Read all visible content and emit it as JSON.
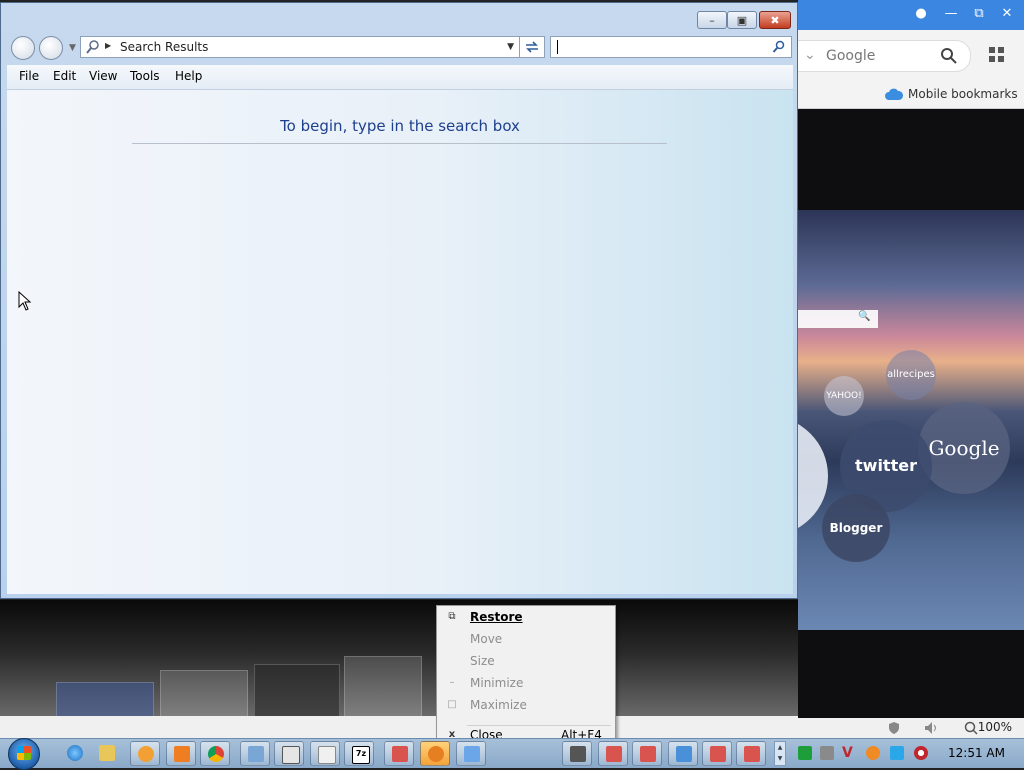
{
  "explorer": {
    "address_text": "Search Results",
    "menu": [
      "File",
      "Edit",
      "View",
      "Tools",
      "Help"
    ],
    "content_hint": "To begin, type in the search box",
    "search_value": ""
  },
  "context_menu": {
    "items": [
      {
        "label": "Restore",
        "icon": "restore-icon",
        "enabled": true,
        "bold": true,
        "shortcut": ""
      },
      {
        "label": "Move",
        "icon": "",
        "enabled": false,
        "bold": false,
        "shortcut": ""
      },
      {
        "label": "Size",
        "icon": "",
        "enabled": false,
        "bold": false,
        "shortcut": ""
      },
      {
        "label": "Minimize",
        "icon": "minimize-icon",
        "enabled": false,
        "bold": false,
        "shortcut": ""
      },
      {
        "label": "Maximize",
        "icon": "maximize-icon",
        "enabled": false,
        "bold": false,
        "shortcut": ""
      },
      {
        "label": "Close",
        "icon": "close-icon",
        "enabled": true,
        "bold": false,
        "shortcut": "Alt+F4"
      }
    ]
  },
  "background_browser": {
    "search_placeholder": "Google",
    "bookmarks_label": "Mobile bookmarks",
    "zoom": "100%",
    "speed_dial": [
      "Google",
      "twitter",
      "YAHOO!",
      "allrecipes",
      "Blogger"
    ]
  },
  "taskbar": {
    "clock": "12:51 AM",
    "seven_zip_label": "7z"
  },
  "colors": {
    "accent": "#3a86e0",
    "explorer_frame": "#c6d9ee",
    "close_red": "#c33c1e"
  }
}
